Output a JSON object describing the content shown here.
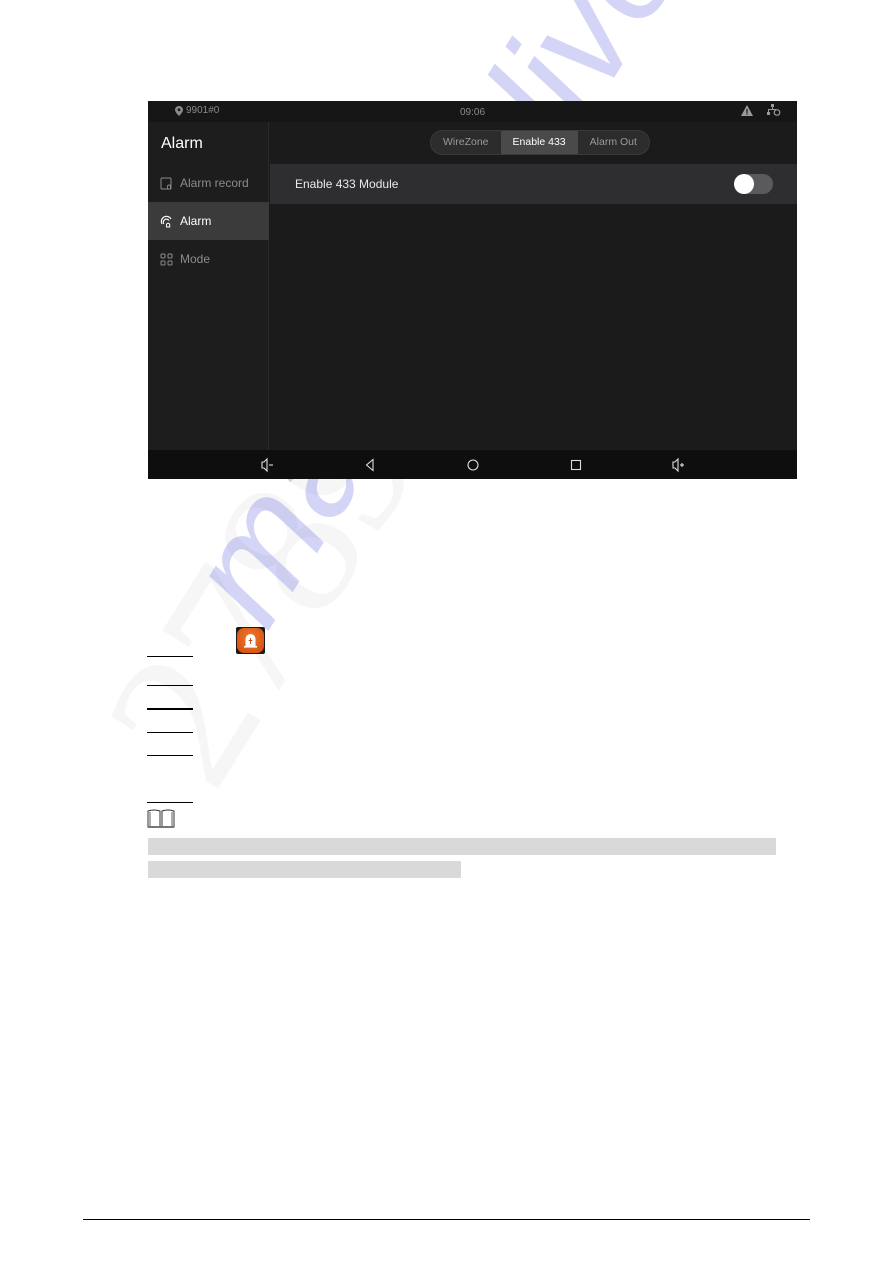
{
  "device": {
    "statusbar": {
      "location_icon": "map-pin-icon",
      "location": "9901#0",
      "time": "09:06",
      "icons": [
        "warning-icon",
        "network-icon"
      ]
    },
    "sidebar": {
      "title": "Alarm",
      "items": [
        {
          "label": "Alarm record",
          "icon": "alarm-record-icon",
          "active": false
        },
        {
          "label": "Alarm",
          "icon": "alarm-icon",
          "active": true
        },
        {
          "label": "Mode",
          "icon": "mode-grid-icon",
          "active": false
        }
      ]
    },
    "tabs": [
      {
        "label": "WireZone",
        "active": false
      },
      {
        "label": "Enable 433",
        "active": true
      },
      {
        "label": "Alarm Out",
        "active": false
      }
    ],
    "settings": [
      {
        "label": "Enable 433 Module",
        "enabled": false
      }
    ],
    "navbar": [
      "volume-down-icon",
      "back-icon",
      "home-icon",
      "recents-icon",
      "volume-up-icon"
    ]
  },
  "document": {
    "inline_icon": "alarm-app-icon",
    "note_icon": "book-note-icon",
    "watermark": "manualslive.com"
  },
  "colors": {
    "screen_bg": "#1b1b1b",
    "active_item": "#3b3b3c",
    "row_bg": "#2e2e30",
    "app_icon": "#e35f1c"
  }
}
